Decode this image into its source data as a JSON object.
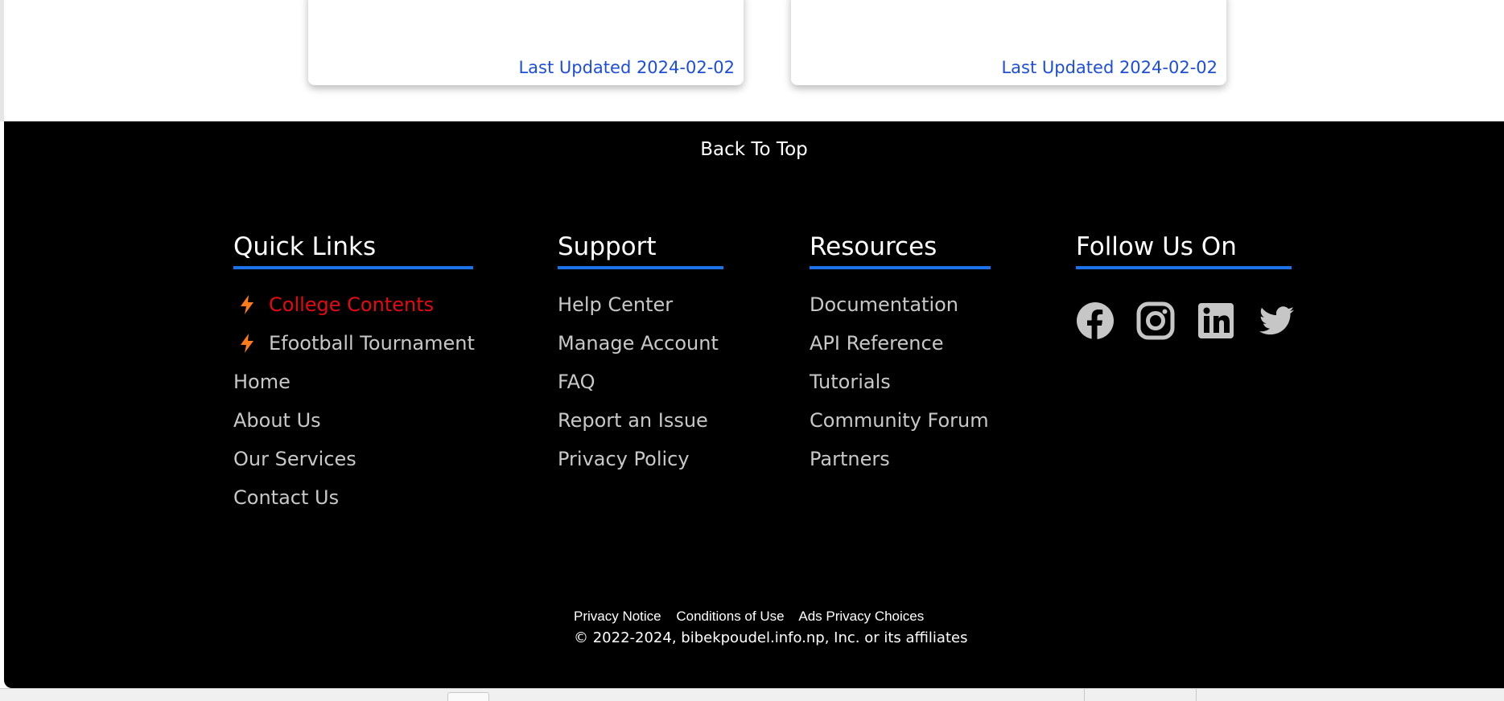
{
  "cards": [
    {
      "updated": "Last Updated 2024-02-02"
    },
    {
      "updated": "Last Updated 2024-02-02"
    }
  ],
  "footer": {
    "back_to_top": "Back To Top",
    "quick_links": {
      "title": "Quick Links",
      "items": [
        "College Contents",
        "Efootball Tournament",
        "Home",
        "About Us",
        "Our Services",
        "Contact Us"
      ]
    },
    "support": {
      "title": "Support",
      "items": [
        "Help Center",
        "Manage Account",
        "FAQ",
        "Report an Issue",
        "Privacy Policy"
      ]
    },
    "resources": {
      "title": "Resources",
      "items": [
        "Documentation",
        "API Reference",
        "Tutorials",
        "Community Forum",
        "Partners"
      ]
    },
    "follow": {
      "title": "Follow Us On",
      "icons": [
        "facebook-icon",
        "instagram-icon",
        "linkedin-icon",
        "twitter-icon"
      ]
    },
    "legal": [
      "Privacy Notice",
      "Conditions of Use",
      "Ads Privacy Choices"
    ],
    "copyright": "© 2022-2024, bibekpoudel.info.np, Inc. or its affiliates"
  },
  "colors": {
    "accent": "#1a73e8",
    "highlight": "#e50914",
    "bolt": "#ff7a1a",
    "link_updated": "#1d4ed8"
  }
}
